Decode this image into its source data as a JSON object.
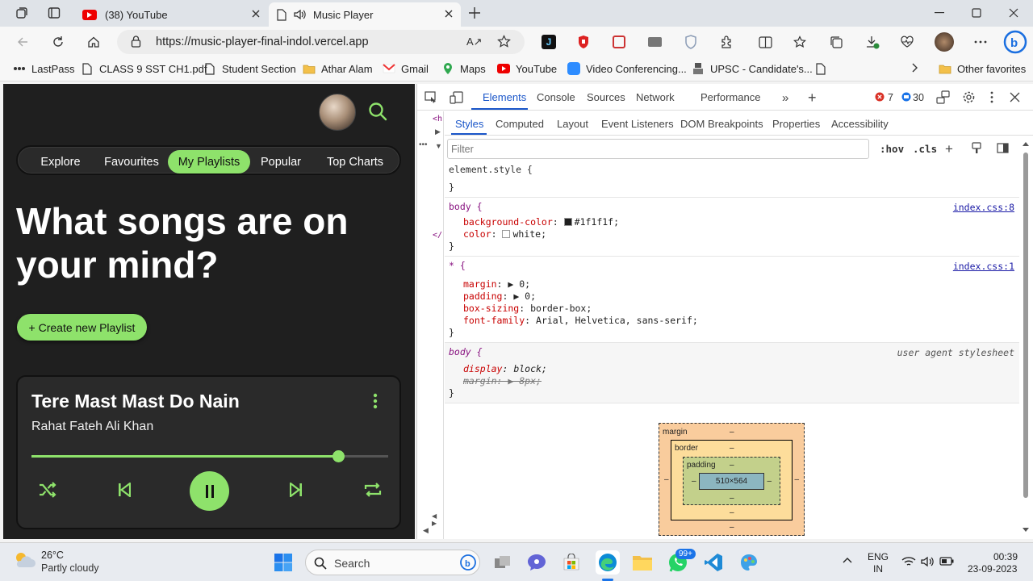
{
  "browser": {
    "tabs": [
      {
        "label": "(38) YouTube",
        "icon": "youtube-icon",
        "active": false
      },
      {
        "label": "Music Player",
        "icon": "audio-icon",
        "active": true
      }
    ],
    "url": "https://music-player-final-indol.vercel.app"
  },
  "bookmarks": [
    {
      "label": "LastPass",
      "icon": "lastpass-icon"
    },
    {
      "label": "CLASS 9 SST CH1.pdf",
      "icon": "document-icon"
    },
    {
      "label": "Student Section",
      "icon": "document-icon"
    },
    {
      "label": "Athar Alam",
      "icon": "folder-icon"
    },
    {
      "label": "Gmail",
      "icon": "gmail-icon"
    },
    {
      "label": "Maps",
      "icon": "maps-icon"
    },
    {
      "label": "YouTube",
      "icon": "youtube-icon"
    },
    {
      "label": "Video Conferencing...",
      "icon": "zoom-icon"
    },
    {
      "label": "UPSC - Candidate's...",
      "icon": "emblem-icon"
    },
    {
      "label": "Other favorites",
      "icon": "folder-icon"
    }
  ],
  "app": {
    "nav": [
      "Explore",
      "Favourites",
      "My Playlists",
      "Popular",
      "Top Charts"
    ],
    "active_nav": "My Playlists",
    "hero_line1": "What songs are on",
    "hero_line2": "your mind?",
    "create_label": "+ Create new Playlist",
    "song_title": "Tere Mast Mast Do Nain",
    "song_artist": "Rahat Fateh Ali Khan",
    "progress": 0.86,
    "accent": "#8ee26b",
    "background": "#1f1f1f"
  },
  "devtools": {
    "tabs": [
      "Elements",
      "Console",
      "Sources",
      "Network",
      "Performance"
    ],
    "active_tab": "Elements",
    "errors": "7",
    "messages": "30",
    "subtabs": [
      "Styles",
      "Computed",
      "Layout",
      "Event Listeners",
      "DOM Breakpoints",
      "Properties",
      "Accessibility"
    ],
    "active_subtab": "Styles",
    "filter_placeholder": "Filter",
    "hov": ":hov",
    "cls": ".cls",
    "rules": {
      "element_style": "element.style {",
      "body_selector": "body {",
      "body_source": "index.css:8",
      "bg_prop": "background-color",
      "bg_value": "#1f1f1f;",
      "color_prop": "color",
      "color_value": "white;",
      "star_selector": "* {",
      "star_source": "index.css:1",
      "margin_prop": "margin",
      "margin_value": "0;",
      "padding_prop": "padding",
      "padding_value": "0;",
      "boxsizing_prop": "box-sizing",
      "boxsizing_value": "border-box;",
      "font_prop": "font-family",
      "font_value": "Arial, Helvetica, sans-serif;",
      "ua_selector": "body {",
      "ua_source": "user agent stylesheet",
      "display_prop": "display",
      "display_value": "block;",
      "uamargin_prop": "margin",
      "uamargin_value": "8px;",
      "close": "}"
    },
    "box_model": {
      "margin_label": "margin",
      "border_label": "border",
      "padding_label": "padding",
      "content": "510×564",
      "dash": "–"
    }
  },
  "taskbar": {
    "weather_temp": "26°C",
    "weather_desc": "Partly cloudy",
    "search": "Search",
    "whatsapp_badge": "99+",
    "lang1": "ENG",
    "lang2": "IN",
    "time": "00:39",
    "date": "23-09-2023"
  }
}
